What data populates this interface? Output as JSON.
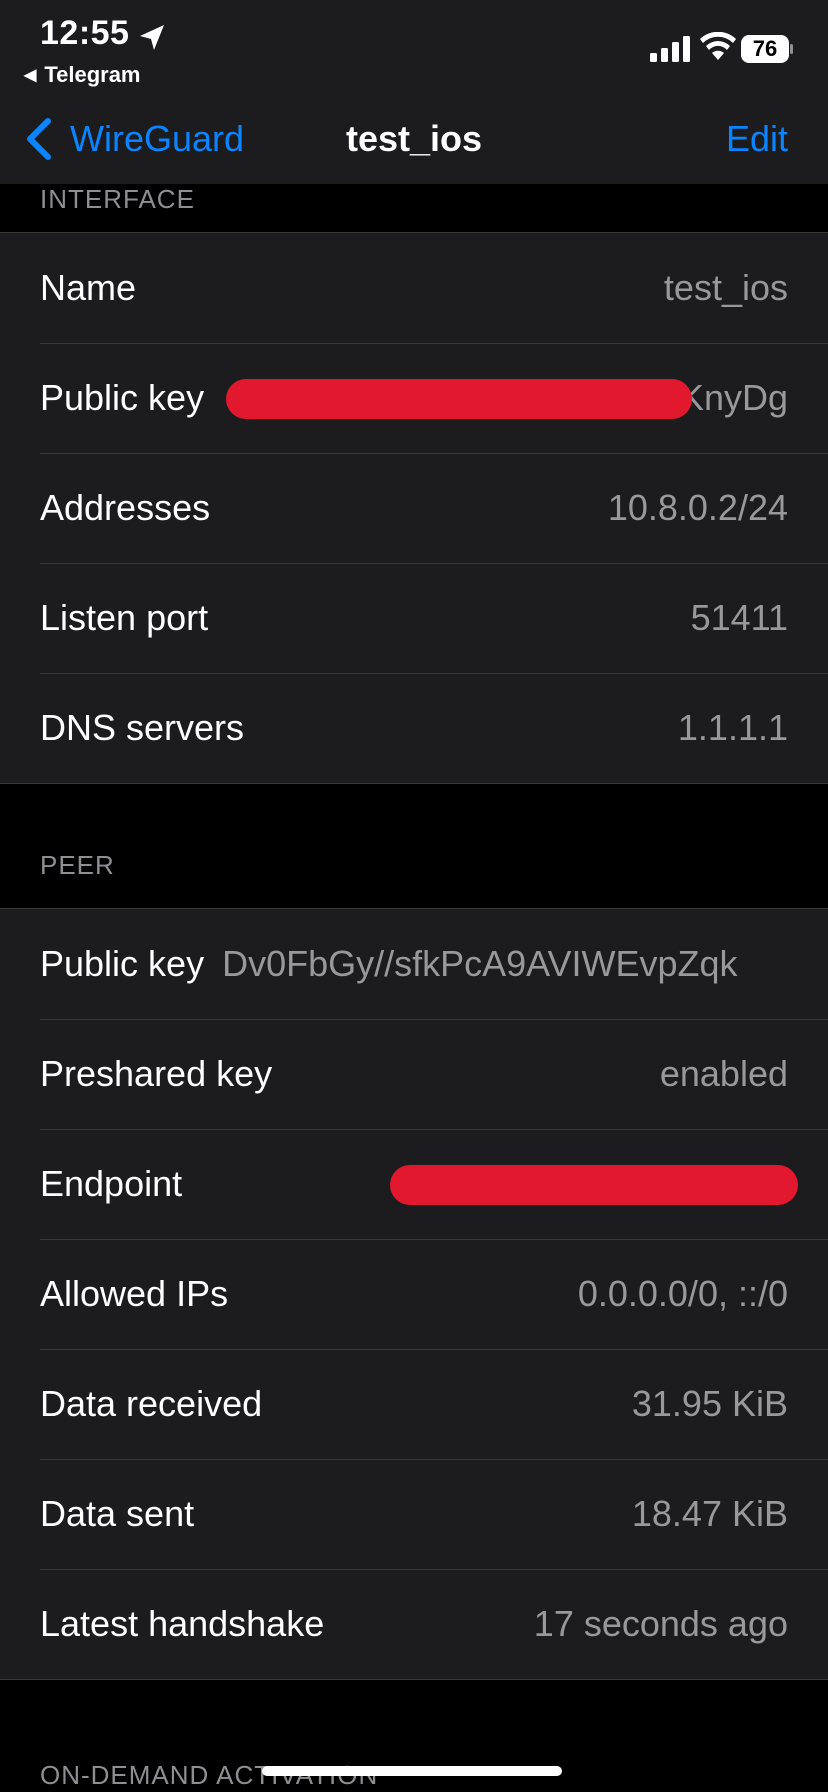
{
  "status_bar": {
    "time": "12:55",
    "back_app": "Telegram",
    "battery": "76"
  },
  "nav": {
    "back_label": "WireGuard",
    "title": "test_ios",
    "edit_label": "Edit"
  },
  "interface": {
    "header": "INTERFACE",
    "rows": [
      {
        "label": "Name",
        "value": "test_ios"
      },
      {
        "label": "Public key",
        "value": "KnyDg"
      },
      {
        "label": "Addresses",
        "value": "10.8.0.2/24"
      },
      {
        "label": "Listen port",
        "value": "51411"
      },
      {
        "label": "DNS servers",
        "value": "1.1.1.1"
      }
    ]
  },
  "peer": {
    "header": "PEER",
    "rows": [
      {
        "label": "Public key",
        "value": "Dv0FbGy//sfkPcA9AVIWEvpZqk"
      },
      {
        "label": "Preshared key",
        "value": "enabled"
      },
      {
        "label": "Endpoint",
        "value": ""
      },
      {
        "label": "Allowed IPs",
        "value": "0.0.0.0/0, ::/0"
      },
      {
        "label": "Data received",
        "value": "31.95 KiB"
      },
      {
        "label": "Data sent",
        "value": "18.47 KiB"
      },
      {
        "label": "Latest handshake",
        "value": "17 seconds ago"
      }
    ]
  },
  "on_demand": {
    "header": "ON-DEMAND ACTIVATION"
  },
  "colors": {
    "accent": "#0a84ff",
    "background": "#000000",
    "cell": "#1c1c1e",
    "redaction": "#e2192e"
  }
}
